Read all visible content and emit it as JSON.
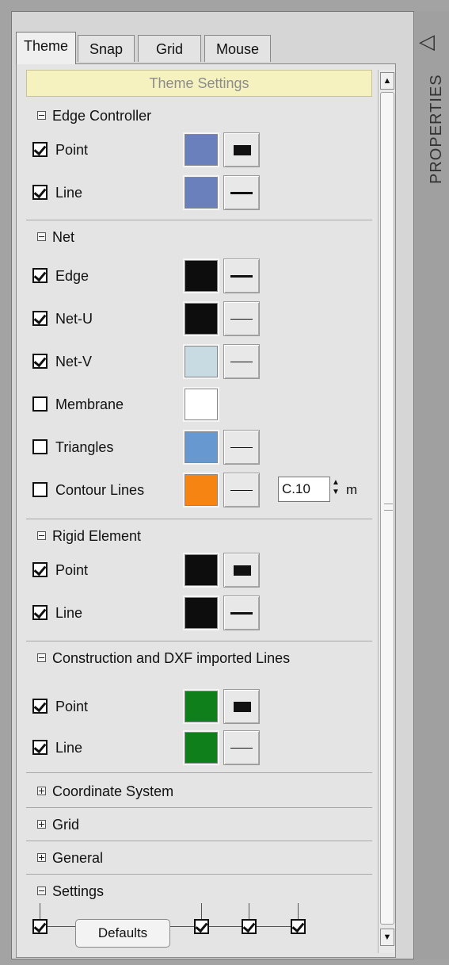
{
  "tabs": [
    {
      "label": "Theme"
    },
    {
      "label": "Snap"
    },
    {
      "label": "Grid"
    },
    {
      "label": "Mouse"
    }
  ],
  "header": {
    "title": "Theme Settings"
  },
  "sidebar": {
    "label": "PROPERTIES",
    "collapse_glyph": "◁"
  },
  "sections": {
    "edge_controller": {
      "title": "Edge Controller",
      "rows": [
        {
          "label": "Point",
          "checked": true,
          "color": "#6a80bd",
          "style": "rect"
        },
        {
          "label": "Line",
          "checked": true,
          "color": "#6a80bd",
          "style": "thick-line"
        }
      ]
    },
    "net": {
      "title": "Net",
      "rows": [
        {
          "label": "Edge",
          "checked": true,
          "color": "#0d0d0d",
          "style": "thick-line"
        },
        {
          "label": "Net-U",
          "checked": true,
          "color": "#0d0d0d",
          "style": "thin-line"
        },
        {
          "label": "Net-V",
          "checked": true,
          "color": "#c9dbe2",
          "style": "thin-line"
        },
        {
          "label": "Membrane",
          "checked": false,
          "color": "#ffffff",
          "style": "none"
        },
        {
          "label": "Triangles",
          "checked": false,
          "color": "#6798cf",
          "style": "thin-line"
        },
        {
          "label": "Contour Lines",
          "checked": false,
          "color": "#f58412",
          "style": "thin-line",
          "spin_value": "C.10",
          "unit": "m"
        }
      ]
    },
    "rigid_element": {
      "title": "Rigid Element",
      "rows": [
        {
          "label": "Point",
          "checked": true,
          "color": "#0d0d0d",
          "style": "rect"
        },
        {
          "label": "Line",
          "checked": true,
          "color": "#0d0d0d",
          "style": "thick-line"
        }
      ]
    },
    "construction": {
      "title": "Construction and DXF imported Lines",
      "rows": [
        {
          "label": "Point",
          "checked": true,
          "color": "#0e7f1a",
          "style": "rect"
        },
        {
          "label": "Line",
          "checked": true,
          "color": "#0e7f1a",
          "style": "thin-line"
        }
      ]
    },
    "coordinate_system": {
      "title": "Coordinate System"
    },
    "grid": {
      "title": "Grid"
    },
    "general": {
      "title": "General"
    },
    "settings": {
      "title": "Settings",
      "defaults_label": "Defaults"
    }
  }
}
